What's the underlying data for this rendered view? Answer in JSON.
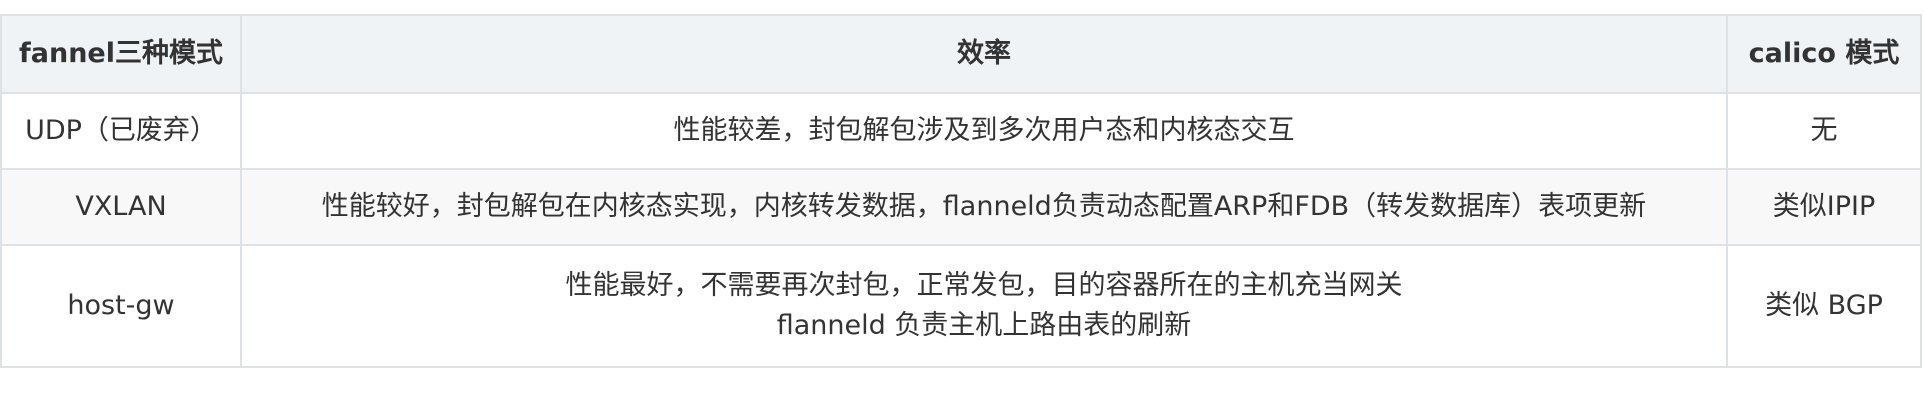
{
  "table": {
    "headers": [
      "fannel三种模式",
      "效率",
      "calico 模式"
    ],
    "rows": [
      {
        "mode": "UDP（已废弃）",
        "efficiency": [
          "性能较差，封包解包涉及到多次用户态和内核态交互"
        ],
        "calico": "无"
      },
      {
        "mode": "VXLAN",
        "efficiency": [
          "性能较好，封包解包在内核态实现，内核转发数据，flanneld负责动态配置ARP和FDB（转发数据库）表项更新"
        ],
        "calico": "类似IPIP"
      },
      {
        "mode": "host-gw",
        "efficiency": [
          "性能最好，不需要再次封包，正常发包，目的容器所在的主机充当网关",
          "flanneld 负责主机上路由表的刷新"
        ],
        "calico": "类似 BGP"
      }
    ]
  }
}
